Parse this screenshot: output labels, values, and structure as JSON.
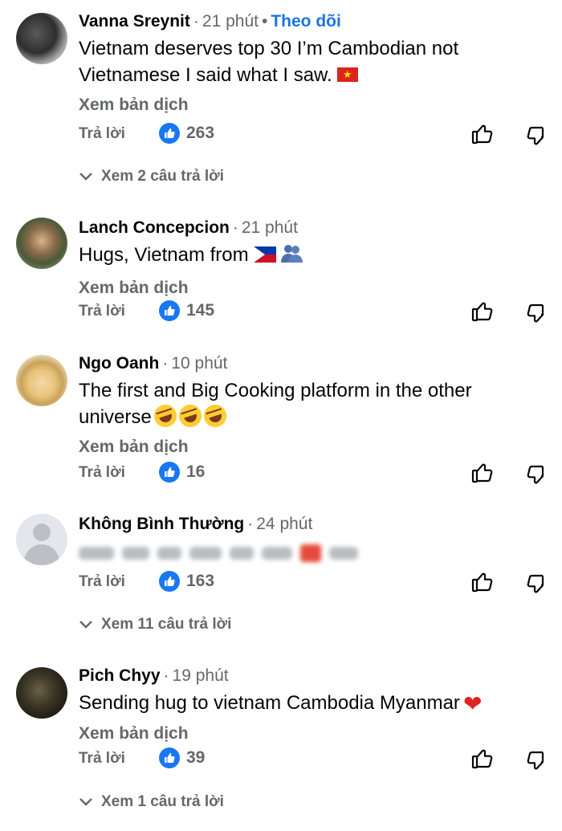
{
  "comments": [
    {
      "name": "Vanna Sreynit",
      "time": "21 phút",
      "follow": "Theo dõi",
      "text": "Vietnam deserves top 30 I’m Cambodian not Vietnamese I said what I saw.",
      "translate": "Xem bản dịch",
      "reply": "Trả lời",
      "likes": "263",
      "view_replies": "Xem 2 câu trả lời"
    },
    {
      "name": "Lanch Concepcion",
      "time": "21 phút",
      "text": "Hugs, Vietnam from",
      "translate": "Xem bản dịch",
      "reply": "Trả lời",
      "likes": "145"
    },
    {
      "name": "Ngo Oanh",
      "time": "10 phút",
      "text": "The first and Big Cooking platform in the other universe",
      "translate": "Xem bản dịch",
      "reply": "Trả lời",
      "likes": "16"
    },
    {
      "name": "Không Bình Thường",
      "time": "24 phút",
      "reply": "Trả lời",
      "likes": "163",
      "view_replies": "Xem 11 câu trả lời"
    },
    {
      "name": "Pich Chyy",
      "time": "19 phút",
      "text": "Sending hug to vietnam Cambodia Myanmar",
      "translate": "Xem bản dịch",
      "reply": "Trả lời",
      "likes": "39",
      "view_replies": "Xem 1 câu trả lời"
    }
  ],
  "icons": {
    "like_badge": "thumbs-up-badge",
    "like_button": "thumbs-up-outline",
    "dislike_button": "thumbs-down-outline",
    "expand": "chevron-down",
    "accent": "#1877f2"
  }
}
